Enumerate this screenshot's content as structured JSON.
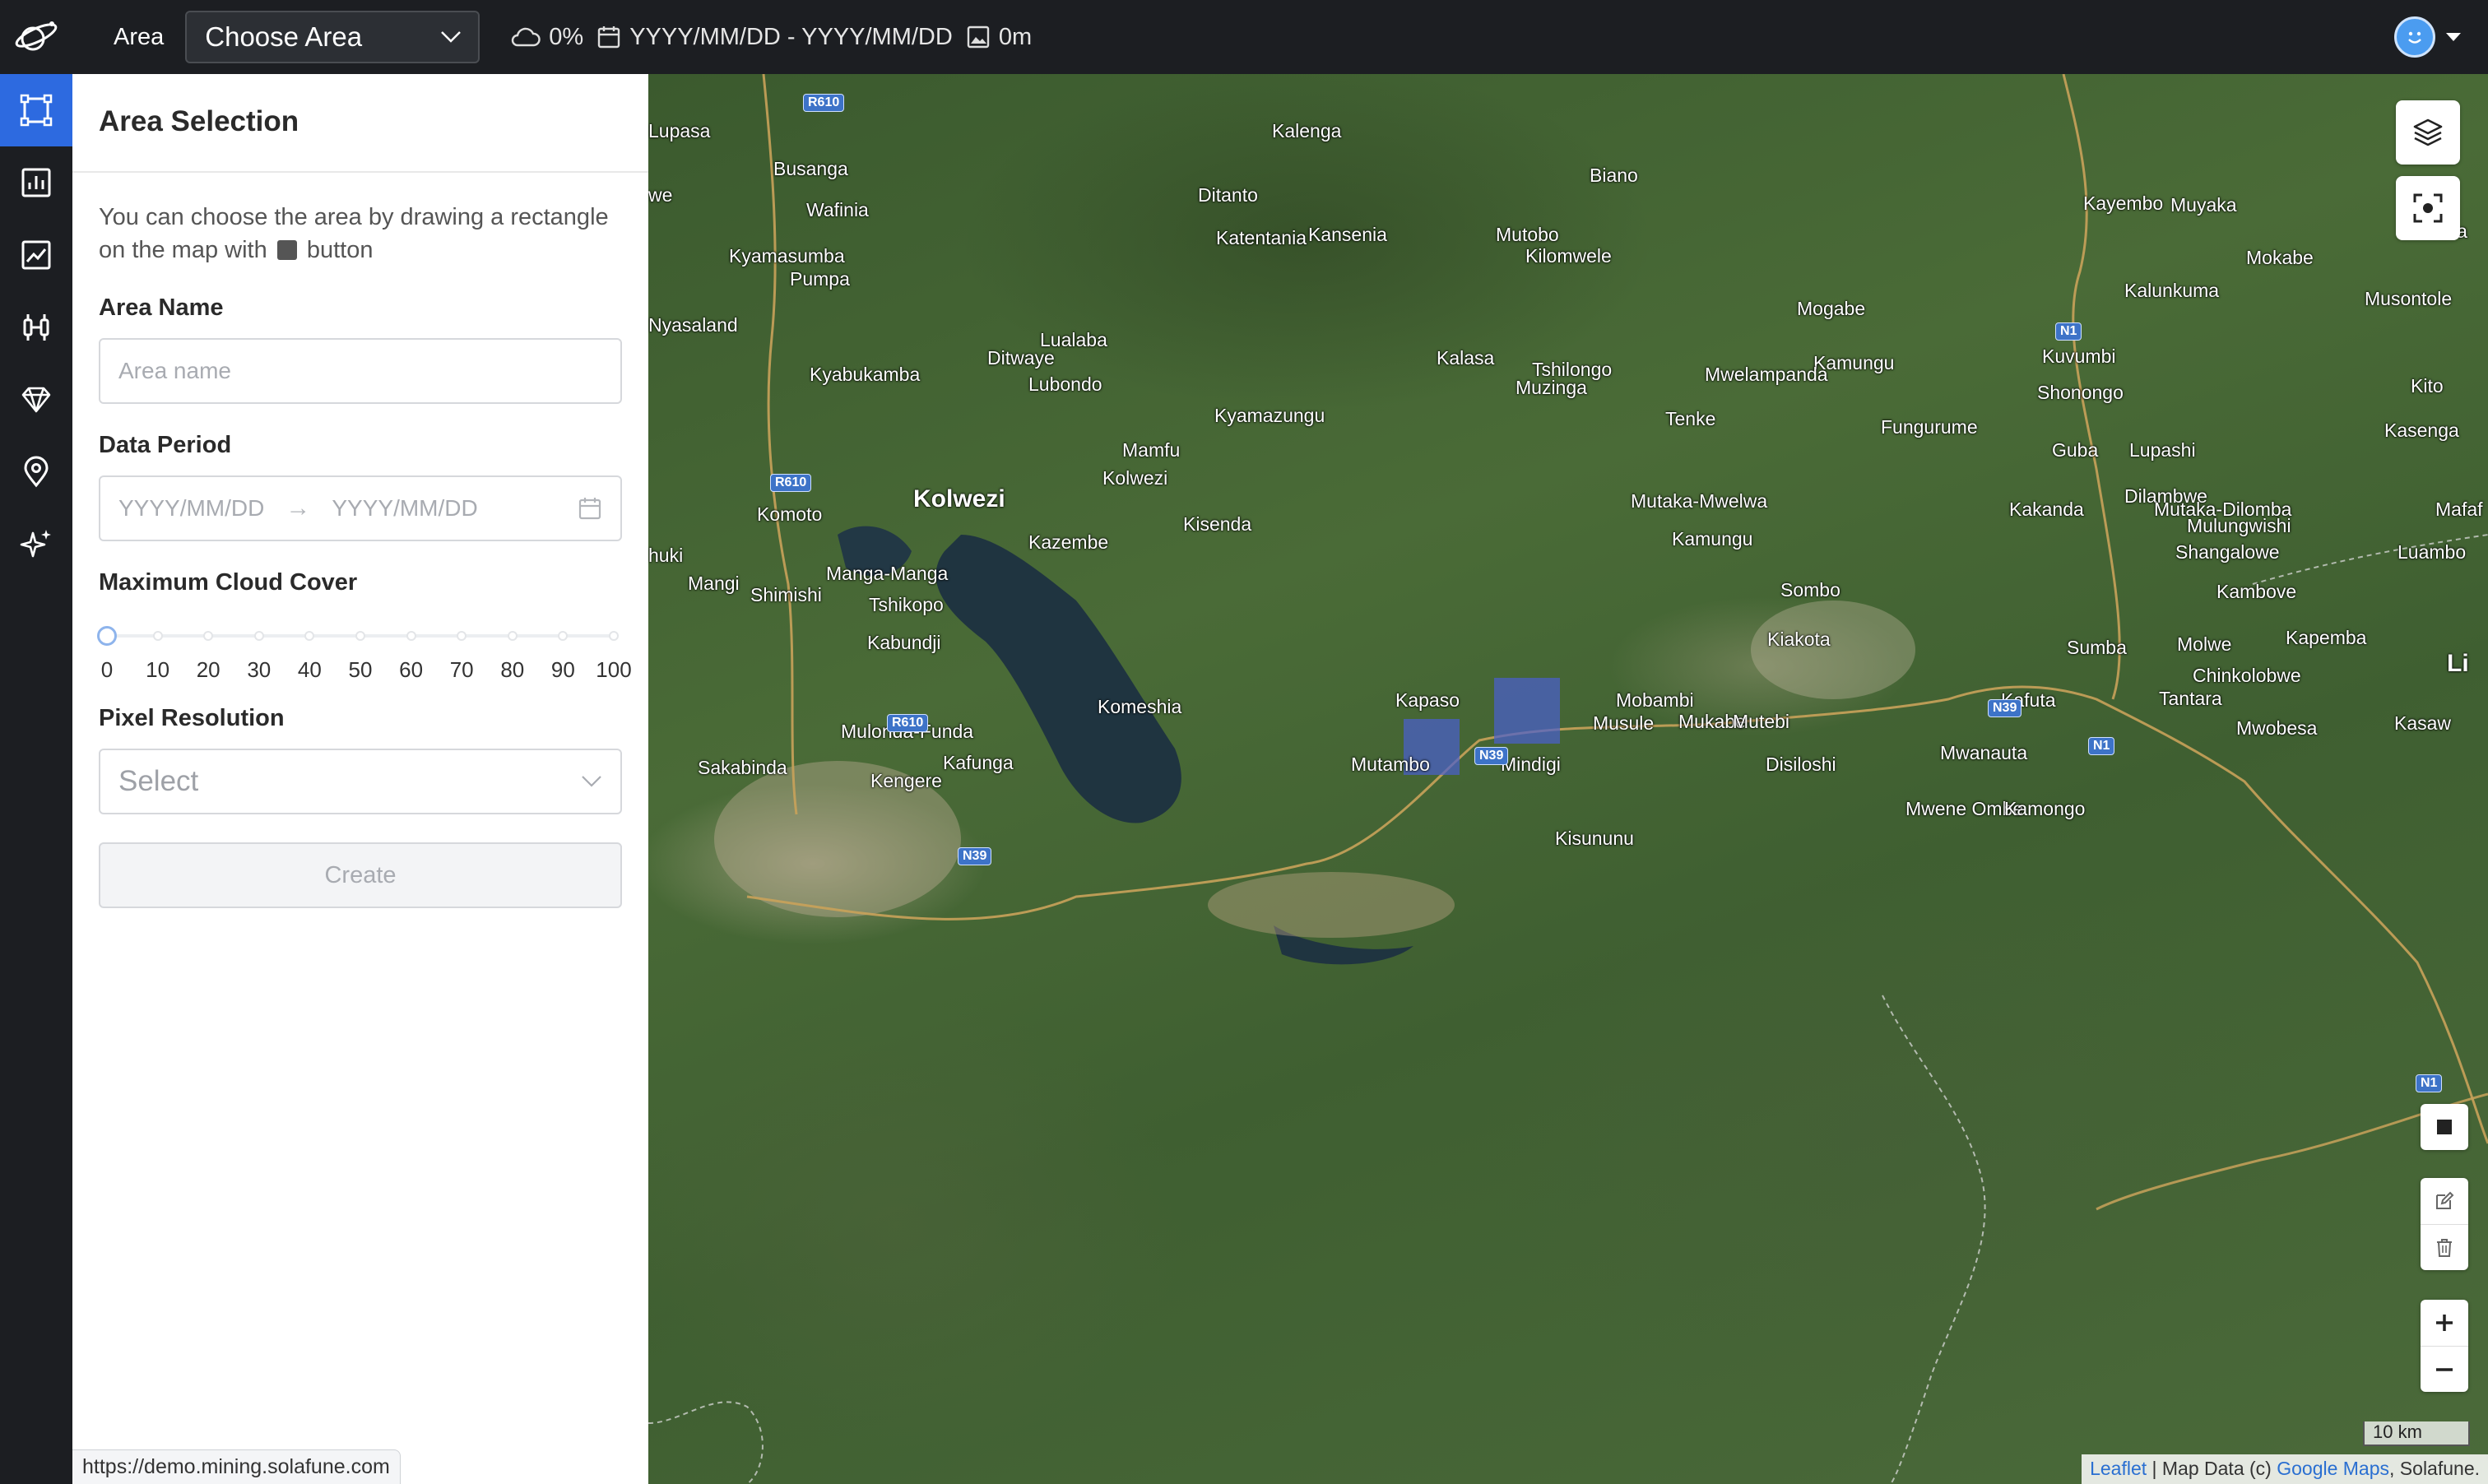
{
  "topbar": {
    "area_label": "Area",
    "area_select_value": "Choose Area",
    "cloud_value": "0%",
    "date_range": "YYYY/MM/DD - YYYY/MM/DD",
    "resolution_value": "0m"
  },
  "panel": {
    "title": "Area Selection",
    "hint_before": "You can choose the area by drawing a rectangle on the map with",
    "hint_after": "button",
    "area_name_label": "Area Name",
    "area_name_placeholder": "Area name",
    "data_period_label": "Data Period",
    "start_placeholder": "YYYY/MM/DD",
    "end_placeholder": "YYYY/MM/DD",
    "cloud_cover_label": "Maximum Cloud Cover",
    "cloud_cover_value": 0,
    "cloud_ticks": [
      "0",
      "10",
      "20",
      "30",
      "40",
      "50",
      "60",
      "70",
      "80",
      "90",
      "100"
    ],
    "pixel_resolution_label": "Pixel Resolution",
    "pixel_resolution_placeholder": "Select",
    "create_label": "Create"
  },
  "status_url": "https://demo.mining.solafune.com",
  "rail_items": [
    "area-icon",
    "bar-chart-icon",
    "line-chart-icon",
    "compare-icon",
    "gem-icon",
    "location-pin-icon",
    "sparkle-icon"
  ],
  "map": {
    "places": [
      {
        "name": "Lupasa",
        "cls": ""
      },
      {
        "name": "Kalenga",
        "cls": ""
      },
      {
        "name": "Biano",
        "cls": ""
      },
      {
        "name": "Busanga",
        "cls": ""
      },
      {
        "name": "Ditanto",
        "cls": ""
      },
      {
        "name": "Kayembo",
        "cls": ""
      },
      {
        "name": "Muyaka",
        "cls": ""
      },
      {
        "name": "Wafinia",
        "cls": ""
      },
      {
        "name": "Kateba",
        "cls": ""
      },
      {
        "name": "Katentania",
        "cls": ""
      },
      {
        "name": "Kansenia",
        "cls": ""
      },
      {
        "name": "Mutobo",
        "cls": ""
      },
      {
        "name": "Kilomwele",
        "cls": ""
      },
      {
        "name": "Kyamasumba",
        "cls": ""
      },
      {
        "name": "Mokabe",
        "cls": ""
      },
      {
        "name": "Pumpa",
        "cls": ""
      },
      {
        "name": "Kalunkuma",
        "cls": ""
      },
      {
        "name": "Musontole",
        "cls": ""
      },
      {
        "name": "Mogabe",
        "cls": ""
      },
      {
        "name": "Nyasaland",
        "cls": ""
      },
      {
        "name": "Lualaba",
        "cls": ""
      },
      {
        "name": "Ditwaye",
        "cls": ""
      },
      {
        "name": "Kalasa",
        "cls": ""
      },
      {
        "name": "Kuvumbi",
        "cls": ""
      },
      {
        "name": "Kamungu",
        "cls": ""
      },
      {
        "name": "Tshilongo",
        "cls": ""
      },
      {
        "name": "Kyabukamba",
        "cls": ""
      },
      {
        "name": "Mwelampanda",
        "cls": ""
      },
      {
        "name": "Lubondo",
        "cls": ""
      },
      {
        "name": "Muzinga",
        "cls": ""
      },
      {
        "name": "Shonongo",
        "cls": ""
      },
      {
        "name": "Kyamazungu",
        "cls": ""
      },
      {
        "name": "Tenke",
        "cls": ""
      },
      {
        "name": "Fungurume",
        "cls": ""
      },
      {
        "name": "Kasenga",
        "cls": ""
      },
      {
        "name": "Mamfu",
        "cls": ""
      },
      {
        "name": "Guba",
        "cls": ""
      },
      {
        "name": "Lupashi",
        "cls": ""
      },
      {
        "name": "Kolwezi",
        "cls": ""
      },
      {
        "name": "Kolwezi",
        "cls": "big"
      },
      {
        "name": "Mutaka-Mwelwa",
        "cls": ""
      },
      {
        "name": "Dilambwe",
        "cls": ""
      },
      {
        "name": "Kakanda",
        "cls": ""
      },
      {
        "name": "Mutaka-Dilomba",
        "cls": ""
      },
      {
        "name": "Komoto",
        "cls": ""
      },
      {
        "name": "Mafaf",
        "cls": ""
      },
      {
        "name": "Mulungwishi",
        "cls": ""
      },
      {
        "name": "Kisenda",
        "cls": ""
      },
      {
        "name": "Kazembe",
        "cls": ""
      },
      {
        "name": "Kamungu",
        "cls": ""
      },
      {
        "name": "Shangalowe",
        "cls": ""
      },
      {
        "name": "Luambo",
        "cls": ""
      },
      {
        "name": "Manga-Manga",
        "cls": ""
      },
      {
        "name": "Mangi",
        "cls": ""
      },
      {
        "name": "Shimishi",
        "cls": ""
      },
      {
        "name": "Sombo",
        "cls": ""
      },
      {
        "name": "Kambove",
        "cls": ""
      },
      {
        "name": "Tshikopo",
        "cls": ""
      },
      {
        "name": "Kabundji",
        "cls": ""
      },
      {
        "name": "Kiakota",
        "cls": ""
      },
      {
        "name": "Kapemba",
        "cls": ""
      },
      {
        "name": "Sumba",
        "cls": ""
      },
      {
        "name": "Molwe",
        "cls": ""
      },
      {
        "name": "Chinkolobwe",
        "cls": ""
      },
      {
        "name": "Kapaso",
        "cls": ""
      },
      {
        "name": "Mobambi",
        "cls": ""
      },
      {
        "name": "Tantara",
        "cls": ""
      },
      {
        "name": "Kafuta",
        "cls": ""
      },
      {
        "name": "Komeshia",
        "cls": ""
      },
      {
        "name": "Musule",
        "cls": ""
      },
      {
        "name": "Mukabe",
        "cls": ""
      },
      {
        "name": "Mutebi",
        "cls": ""
      },
      {
        "name": "Mwobesa",
        "cls": ""
      },
      {
        "name": "Kasaw",
        "cls": ""
      },
      {
        "name": "Mulonda-Funda",
        "cls": ""
      },
      {
        "name": "Kafunga",
        "cls": ""
      },
      {
        "name": "Mwanauta",
        "cls": ""
      },
      {
        "name": "Disiloshi",
        "cls": ""
      },
      {
        "name": "Sakabinda",
        "cls": ""
      },
      {
        "name": "Mutambo",
        "cls": ""
      },
      {
        "name": "Mindigi",
        "cls": ""
      },
      {
        "name": "Kengere",
        "cls": ""
      },
      {
        "name": "Mwene Ombe",
        "cls": ""
      },
      {
        "name": "Kamongo",
        "cls": ""
      },
      {
        "name": "Kisununu",
        "cls": ""
      },
      {
        "name": "Kito",
        "cls": ""
      },
      {
        "name": "we",
        "cls": ""
      },
      {
        "name": "huki",
        "cls": ""
      },
      {
        "name": "Li",
        "cls": "big"
      }
    ],
    "shields": [
      "R610",
      "R610",
      "R610",
      "N39",
      "N39",
      "N39",
      "N1",
      "N1",
      "N1"
    ],
    "scale_label": "10 km",
    "attribution": {
      "leaflet": "Leaflet",
      "map_data": " | Map Data (c) ",
      "google": "Google Maps",
      "solafune": ", Solafune."
    }
  },
  "colors": {
    "accent": "#2d6ae0",
    "topbar_bg": "#1c1e22",
    "panel_bg": "#ffffff",
    "overlay_tile": "#4a5fd0"
  }
}
